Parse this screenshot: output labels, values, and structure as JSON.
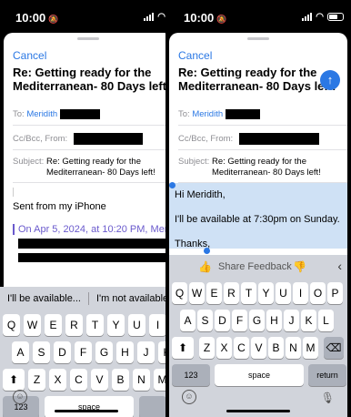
{
  "left": {
    "time": "10:00",
    "cancel": "Cancel",
    "subject_title_line1": "Re: Getting ready for the",
    "subject_title_line2": "Mediterranean- 80 Days left!",
    "to_label": "To:",
    "to_name": "Meridith",
    "cc_label": "Cc/Bcc, From:",
    "subject_label": "Subject:",
    "subject_value_line1": "Re: Getting ready for the",
    "subject_value_line2": "Mediterranean- 80 Days left!",
    "signature": "Sent from my iPhone",
    "quote": "On Apr 5, 2024, at 10:20 PM, Meri",
    "suggestions": [
      "I'll be available...",
      "I'm not available"
    ],
    "keys_row1": [
      "Q",
      "W",
      "E",
      "R",
      "T",
      "Y",
      "U",
      "I"
    ],
    "keys_row2": [
      "A",
      "S",
      "D",
      "F",
      "G",
      "H",
      "J",
      "K"
    ],
    "keys_row3": [
      "Z",
      "X",
      "C",
      "V",
      "B",
      "N",
      "M"
    ],
    "key_123": "123",
    "key_space": "space"
  },
  "right": {
    "time": "10:00",
    "cancel": "Cancel",
    "subject_title_line1": "Re: Getting ready for the",
    "subject_title_line2": "Mediterranean- 80 Days left!",
    "to_label": "To:",
    "to_name": "Meridith",
    "cc_label": "Cc/Bcc, From:",
    "subject_label": "Subject:",
    "subject_value_line1": "Re: Getting ready for the",
    "subject_value_line2": "Mediterranean- 80 Days left!",
    "greeting": "Hi Meridith,",
    "line2": "I'll be available at 7:30pm on Sunday.",
    "thanks": "Thanks,",
    "feedback": "Share Feedback",
    "keys_row1": [
      "Q",
      "W",
      "E",
      "R",
      "T",
      "Y",
      "U",
      "I",
      "O",
      "P"
    ],
    "keys_row2": [
      "A",
      "S",
      "D",
      "F",
      "G",
      "H",
      "J",
      "K",
      "L"
    ],
    "keys_row3": [
      "Z",
      "X",
      "C",
      "V",
      "B",
      "N",
      "M"
    ],
    "key_123": "123",
    "key_space": "space",
    "key_return": "return"
  },
  "colors": {
    "accent": "#2b78e4",
    "selection": "#cfe1f5",
    "backdrop": "#c9e0f4"
  },
  "icons": [
    "bell-slash-icon",
    "signal-icon",
    "wifi-icon",
    "battery-icon",
    "send-arrow-icon",
    "thumbs-up-icon",
    "thumbs-down-icon",
    "chevron-left-icon",
    "shift-icon",
    "delete-icon",
    "emoji-icon",
    "microphone-icon"
  ]
}
